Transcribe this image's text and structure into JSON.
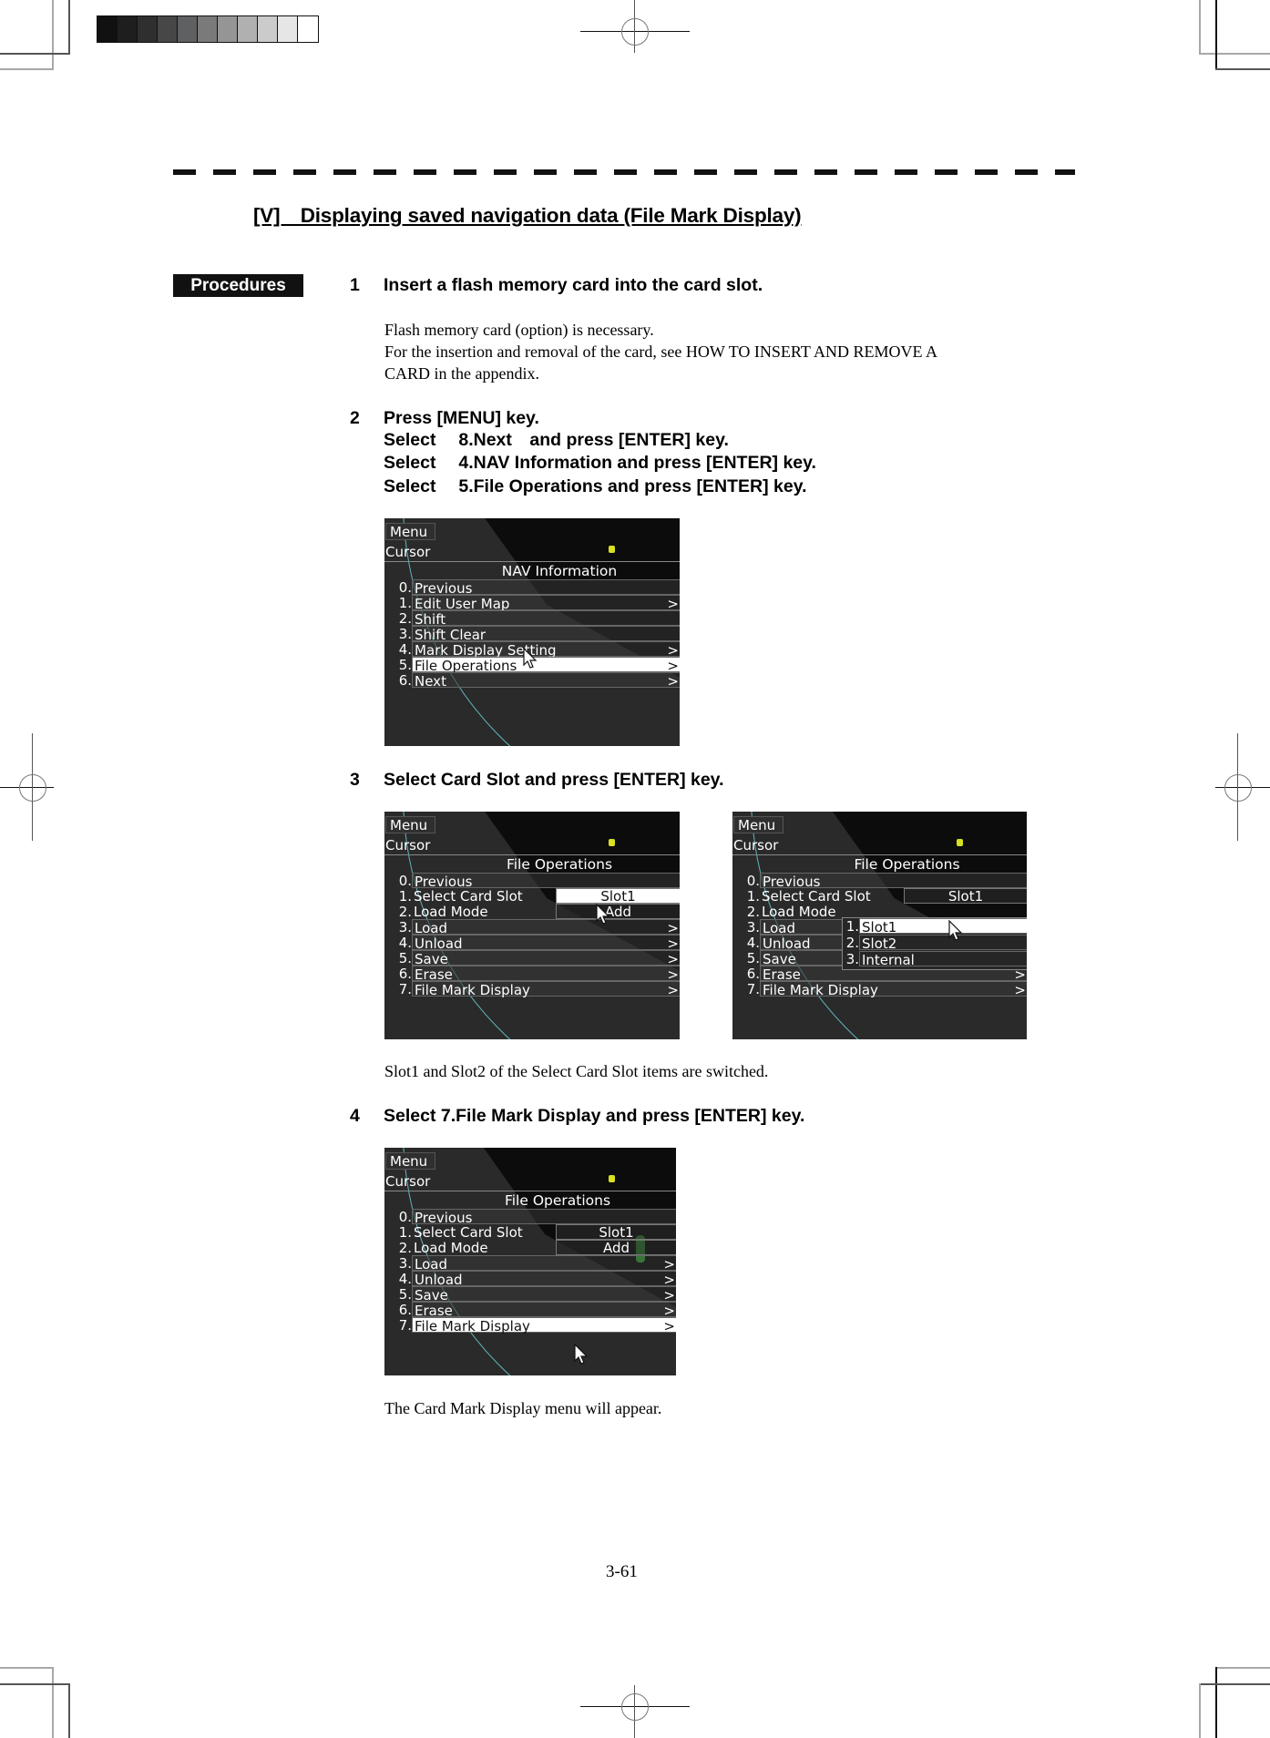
{
  "section_title": "[V] Displaying saved navigation data (File Mark Display)",
  "procedures_label": "Procedures",
  "steps": [
    {
      "num": "1",
      "text": "Insert a flash memory card into the card slot."
    },
    {
      "num": "2",
      "text": "Press [MENU] key.",
      "sub": [
        "Select  8.Next and press [ENTER] key.",
        "Select  4.NAV Information and press [ENTER] key.",
        "Select  5.File Operations and press [ENTER] key."
      ]
    },
    {
      "num": "3",
      "text": "Select Card Slot and press [ENTER] key."
    },
    {
      "num": "4",
      "text": "Select 7.File Mark Display and press [ENTER] key."
    }
  ],
  "notes": {
    "step1": [
      "Flash memory card (option) is necessary.",
      "For the insertion and removal of the card, see HOW TO INSERT AND REMOVE A",
      "CARD in the appendix."
    ],
    "step3": "Slot1 and Slot2 of the Select Card Slot items are switched.",
    "step4": "The Card Mark Display menu will appear."
  },
  "page_number": "3-61",
  "screens": {
    "nav_info": {
      "menu_tab": "Menu",
      "cursor_label": "Cursor",
      "title": "NAV Information",
      "items": [
        {
          "idx": "0.",
          "label": "Previous",
          "arrow": ""
        },
        {
          "idx": "1.",
          "label": "Edit User Map",
          "arrow": ">"
        },
        {
          "idx": "2.",
          "label": "Shift",
          "arrow": ""
        },
        {
          "idx": "3.",
          "label": "Shift Clear",
          "arrow": ""
        },
        {
          "idx": "4.",
          "label": "Mark Display Setting",
          "arrow": ">"
        },
        {
          "idx": "5.",
          "label": "File Operations",
          "arrow": ">",
          "selected": true
        },
        {
          "idx": "6.",
          "label": "Next",
          "arrow": ">"
        }
      ]
    },
    "file_ops": {
      "menu_tab": "Menu",
      "cursor_label": "Cursor",
      "title": "File Operations",
      "items": [
        {
          "idx": "0.",
          "label": "Previous",
          "arrow": ""
        },
        {
          "idx": "1.",
          "label": "Select Card Slot",
          "value": "Slot1"
        },
        {
          "idx": "2.",
          "label": "Load Mode",
          "value": "Add"
        },
        {
          "idx": "3.",
          "label": "Load",
          "arrow": ">"
        },
        {
          "idx": "4.",
          "label": "Unload",
          "arrow": ">"
        },
        {
          "idx": "5.",
          "label": "Save",
          "arrow": ">"
        },
        {
          "idx": "6.",
          "label": "Erase",
          "arrow": ">"
        },
        {
          "idx": "7.",
          "label": "File Mark Display",
          "arrow": ">"
        }
      ],
      "slot_dropdown": [
        {
          "idx": "1.",
          "label": "Slot1",
          "selected": true
        },
        {
          "idx": "2.",
          "label": "Slot2"
        },
        {
          "idx": "3.",
          "label": "Internal"
        }
      ]
    }
  },
  "grayscale_swatches": [
    "#111111",
    "#1e1e1e",
    "#2f2f2f",
    "#474747",
    "#5f6061",
    "#7a7a7a",
    "#959595",
    "#b0b0b0",
    "#cbcbcb",
    "#e6e6e6",
    "#ffffff"
  ]
}
